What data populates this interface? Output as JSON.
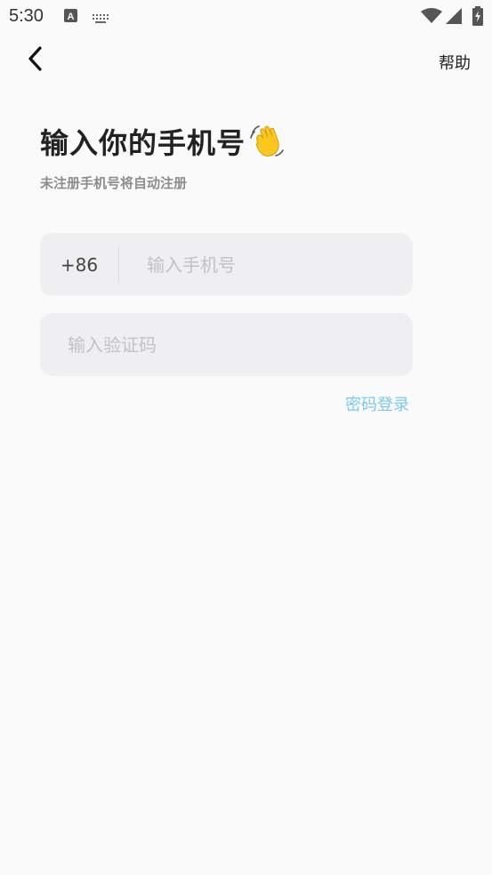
{
  "status_bar": {
    "time": "5:30",
    "icons": [
      "a-icon",
      "keyboard-icon",
      "wifi-icon",
      "signal-icon",
      "battery-icon"
    ]
  },
  "header": {
    "back_icon": "chevron-left-icon",
    "help_label": "帮助"
  },
  "main": {
    "title": "输入你的手机号",
    "title_emoji": "waving-hand-icon",
    "subtitle": "未注册手机号将自动注册",
    "phone": {
      "country_code": "+86",
      "placeholder": "输入手机号",
      "value": ""
    },
    "code": {
      "placeholder": "输入验证码",
      "value": ""
    },
    "password_login_label": "密码登录"
  },
  "colors": {
    "background": "#fafafa",
    "field_background": "#efeff1",
    "accent": "#7cc8ea",
    "placeholder": "#c2c2c6",
    "subtitle": "#8c8c8c"
  }
}
